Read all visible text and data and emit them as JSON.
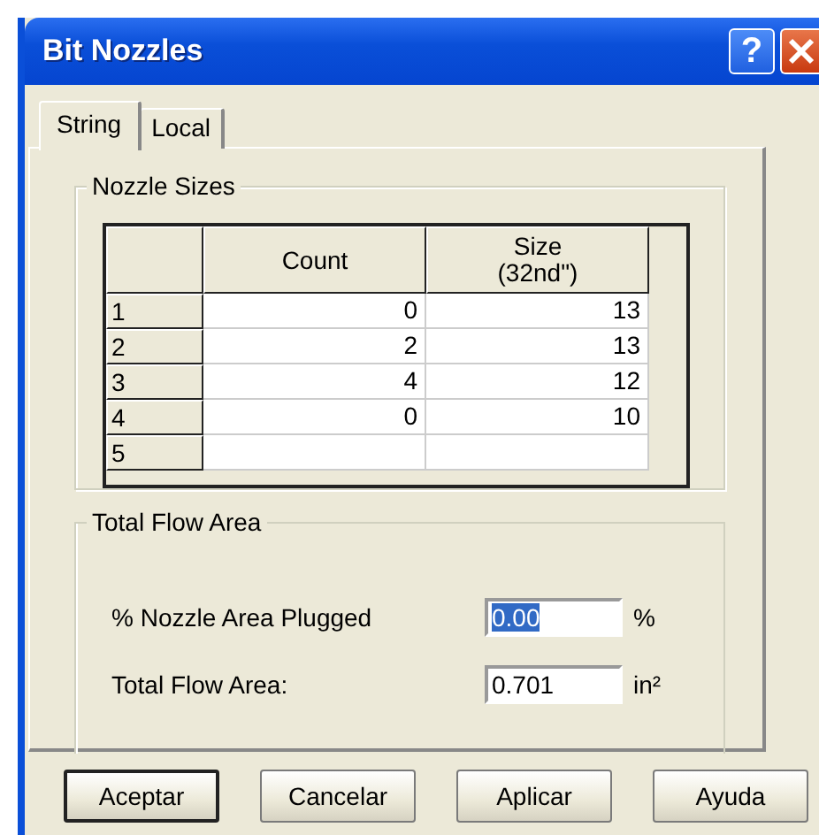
{
  "window": {
    "title": "Bit Nozzles",
    "help_button": "?"
  },
  "tabs": [
    {
      "label": "String",
      "selected": true
    },
    {
      "label": "Local",
      "selected": false
    }
  ],
  "nozzle_sizes": {
    "title": "Nozzle Sizes",
    "columns": [
      {
        "lines": [
          "Count"
        ]
      },
      {
        "lines": [
          "Size",
          "(32nd\")"
        ]
      }
    ],
    "rows": [
      {
        "header": "1",
        "count": "0",
        "size": "13"
      },
      {
        "header": "2",
        "count": "2",
        "size": "13"
      },
      {
        "header": "3",
        "count": "4",
        "size": "12"
      },
      {
        "header": "4",
        "count": "0",
        "size": "10"
      },
      {
        "header": "5"
      }
    ]
  },
  "total_flow_area": {
    "title": "Total Flow Area",
    "fields": [
      {
        "label": "% Nozzle Area Plugged",
        "value": "0.00",
        "text_selected": true,
        "unit": "%"
      },
      {
        "label": "Total Flow Area:",
        "value": "0.701",
        "text_selected": false,
        "unit": "in²"
      }
    ]
  },
  "buttons": [
    {
      "label": "Aceptar",
      "default": true
    },
    {
      "label": "Cancelar",
      "default": false
    },
    {
      "label": "Aplicar",
      "default": false
    },
    {
      "label": "Ayuda",
      "default": false
    }
  ]
}
